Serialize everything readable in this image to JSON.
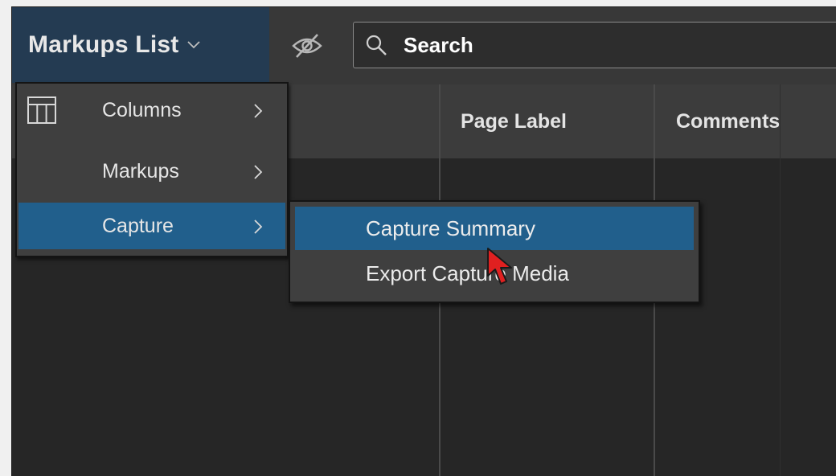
{
  "window": {
    "title": "Markups List"
  },
  "toolbar": {
    "title_icon": "chevron-down-icon",
    "visibility_icon": "eye-off-icon",
    "search": {
      "placeholder": "Search",
      "value": "",
      "icon": "search-icon"
    }
  },
  "table": {
    "columns": [
      {
        "label": ""
      },
      {
        "label": "Page Label"
      },
      {
        "label": "Comments"
      }
    ]
  },
  "menu": {
    "items": [
      {
        "label": "Columns",
        "icon": "columns-grid-icon",
        "has_submenu": true,
        "active": false
      },
      {
        "label": "Markups",
        "icon": "",
        "has_submenu": true,
        "active": false
      },
      {
        "label": "Capture",
        "icon": "",
        "has_submenu": true,
        "active": true
      }
    ]
  },
  "submenu": {
    "items": [
      {
        "label": "Capture Summary",
        "active": true
      },
      {
        "label": "Export Capture Media",
        "active": false
      }
    ]
  },
  "colors": {
    "accent": "#215f8c",
    "title_bg": "#243b52",
    "panel_bg": "#262626",
    "header_bg": "#3c3c3c",
    "menu_bg": "#3f3f3f",
    "cursor": "#e02020"
  }
}
